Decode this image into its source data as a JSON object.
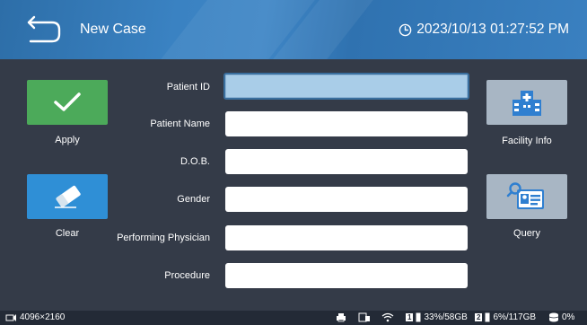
{
  "header": {
    "title": "New Case",
    "datetime": "2023/10/13 01:27:52 PM"
  },
  "actions": {
    "apply_label": "Apply",
    "clear_label": "Clear",
    "facility_label": "Facility Info",
    "query_label": "Query"
  },
  "form": {
    "fields": [
      {
        "label": "Patient ID",
        "value": ""
      },
      {
        "label": "Patient Name",
        "value": ""
      },
      {
        "label": "D.O.B.",
        "value": ""
      },
      {
        "label": "Gender",
        "value": ""
      },
      {
        "label": "Performing Physician",
        "value": ""
      },
      {
        "label": "Procedure",
        "value": ""
      }
    ]
  },
  "status": {
    "resolution": "4096×2160",
    "disk1_badge": "1",
    "disk1_usage": "33%/58GB",
    "disk2_badge": "2",
    "disk2_usage": "6%/117GB",
    "storage_usage": "0%"
  },
  "colors": {
    "header": "#3a80c0",
    "background": "#343b48",
    "apply": "#4caa5a",
    "clear": "#2f8fd6",
    "facility": "#a8b6c4",
    "query": "#a8b6c4",
    "active_field": "#a9cde8"
  }
}
